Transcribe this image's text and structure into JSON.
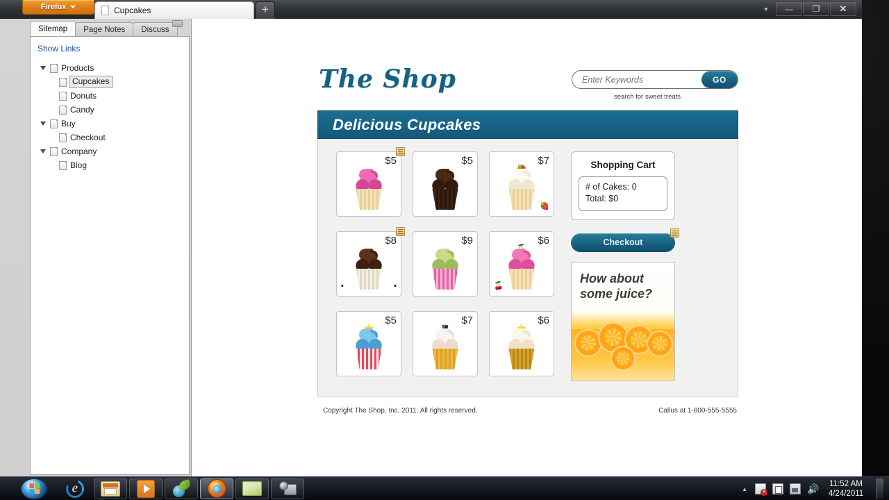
{
  "browser": {
    "firefox_button": "Firefox",
    "tab_title": "Cupcakes",
    "new_tab_label": "+",
    "window_controls": {
      "minimize": "—",
      "restore": "❐",
      "close": "✕",
      "caret": "▼"
    }
  },
  "sidebar": {
    "tabs": [
      {
        "label": "Sitemap",
        "active": true
      },
      {
        "label": "Page Notes",
        "active": false
      },
      {
        "label": "Discuss",
        "active": false
      }
    ],
    "show_links": "Show Links",
    "tree": [
      {
        "label": "Products",
        "level": 0,
        "expanded": true,
        "selected": false
      },
      {
        "label": "Cupcakes",
        "level": 1,
        "expanded": false,
        "selected": true
      },
      {
        "label": "Donuts",
        "level": 1,
        "expanded": false,
        "selected": false
      },
      {
        "label": "Candy",
        "level": 1,
        "expanded": false,
        "selected": false
      },
      {
        "label": "Buy",
        "level": 0,
        "expanded": true,
        "selected": false
      },
      {
        "label": "Checkout",
        "level": 1,
        "expanded": false,
        "selected": false
      },
      {
        "label": "Company",
        "level": 0,
        "expanded": true,
        "selected": false
      },
      {
        "label": "Blog",
        "level": 1,
        "expanded": false,
        "selected": false
      }
    ]
  },
  "site": {
    "logo": "The Shop",
    "search": {
      "value": "",
      "placeholder": "Enter Keywords",
      "go_label": "GO",
      "subtext": "search for sweet treats"
    },
    "banner_title": "Delicious Cupcakes",
    "products": [
      {
        "price": "$5",
        "name": "pink-swirl-cupcake",
        "has_note": true,
        "f1": "#f06bb0",
        "f2": "#d8459a",
        "liner1": "#f6e3b8",
        "liner2": "#e7cf98",
        "topper": "",
        "deco_left": "",
        "deco_right": ""
      },
      {
        "price": "$5",
        "name": "chocolate-cupcake",
        "has_note": false,
        "f1": "#4a2a17",
        "f2": "#331a0d",
        "liner1": "#3d2414",
        "liner2": "#2a160b",
        "topper": "",
        "deco_left": "",
        "deco_right": ""
      },
      {
        "price": "$7",
        "name": "strawberry-cream-cupcake",
        "has_note": false,
        "f1": "#fdfaf2",
        "f2": "#efe7d6",
        "liner1": "#f6e3b8",
        "liner2": "#e7cf98",
        "topper": "🍓",
        "deco_left": "",
        "deco_right": "🍓"
      },
      {
        "price": "$8",
        "name": "mocha-coffee-cupcake",
        "has_note": true,
        "f1": "#5a3318",
        "f2": "#3d2010",
        "liner1": "#f3efe2",
        "liner2": "#ded9c6",
        "topper": "",
        "deco_left": "•",
        "deco_right": "•"
      },
      {
        "price": "$9",
        "name": "pistachio-cupcake",
        "has_note": false,
        "f1": "#c9d98c",
        "f2": "#9cbb5a",
        "liner1": "#e85fa5",
        "liner2": "#f4b3d4",
        "topper": "",
        "deco_left": "",
        "deco_right": ""
      },
      {
        "price": "$6",
        "name": "cherry-cupcake",
        "has_note": false,
        "f1": "#f27ab4",
        "f2": "#dd4f9b",
        "liner1": "#f6e3b8",
        "liner2": "#e7cf98",
        "topper": "🍒",
        "deco_left": "🍒",
        "deco_right": ""
      },
      {
        "price": "$5",
        "name": "patriotic-swirl-cupcake",
        "has_note": false,
        "f1": "#7ec7ea",
        "f2": "#4a9ed4",
        "liner1": "#e04b5e",
        "liner2": "#f8e7ea",
        "topper": "⭐",
        "deco_left": "",
        "deco_right": ""
      },
      {
        "price": "$7",
        "name": "top-hat-cupcake",
        "has_note": false,
        "f1": "#fbf4ee",
        "f2": "#eedcd2",
        "liner1": "#f0b93c",
        "liner2": "#d9a12c",
        "topper": "🎩",
        "deco_left": "",
        "deco_right": ""
      },
      {
        "price": "$6",
        "name": "gold-star-cupcake",
        "has_note": false,
        "f1": "#fbf6e7",
        "f2": "#eee3c7",
        "liner1": "#d9a42a",
        "liner2": "#b9861c",
        "topper": "⭐",
        "deco_left": "",
        "deco_right": ""
      }
    ],
    "cart": {
      "title": "Shopping Cart",
      "cakes_line": "# of Cakes: 0",
      "total_line": "Total: $0",
      "checkout_label": "Checkout"
    },
    "ad": {
      "line1": "How about",
      "line2": "some juice?"
    },
    "footer": {
      "copyright": "Copyright The Shop, Inc. 2011. All rights reserved.",
      "callus": "Callus at 1-800-555-5555"
    }
  },
  "taskbar": {
    "items": [
      {
        "name": "internet-explorer",
        "icon": "ic-ie",
        "framed": false,
        "active": false
      },
      {
        "name": "windows-explorer",
        "icon": "ic-folder",
        "framed": true,
        "active": false
      },
      {
        "name": "media-player",
        "icon": "ic-wmp",
        "framed": true,
        "active": false
      },
      {
        "name": "plant-app",
        "icon": "ic-plant",
        "framed": true,
        "active": false
      },
      {
        "name": "firefox",
        "icon": "ic-ff",
        "framed": true,
        "active": true
      },
      {
        "name": "notes-app",
        "icon": "ic-notes",
        "framed": true,
        "active": false
      },
      {
        "name": "screen-capture-app",
        "icon": "ic-cam",
        "framed": true,
        "active": false
      }
    ],
    "tray": {
      "caret": "▲",
      "volume": "🔊"
    },
    "clock": {
      "time": "11:52 AM",
      "date": "4/24/2011"
    }
  }
}
